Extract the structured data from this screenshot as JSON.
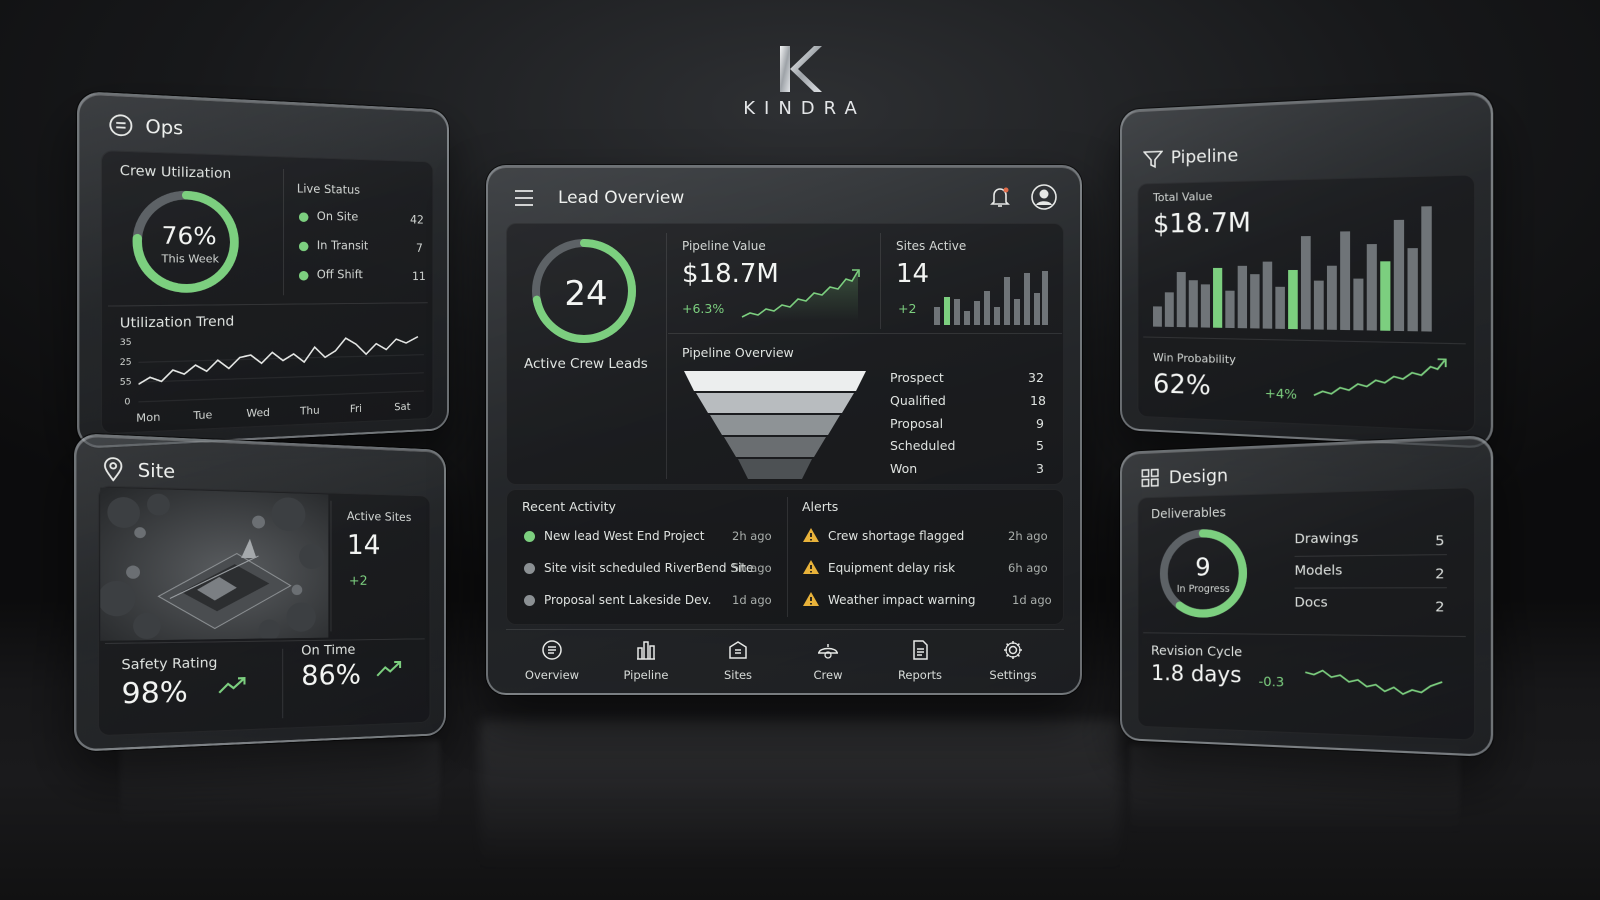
{
  "brand": {
    "mark": "K",
    "name": "KINDRA"
  },
  "colors": {
    "accent": "#7ccf7f",
    "panel_border": "#d7dee2",
    "warning": "#e8b23a"
  },
  "ops": {
    "title": "Ops",
    "icon": "ops-icon",
    "crew_utilization": {
      "label": "Crew Utilization",
      "value": "76%",
      "sub": "This Week",
      "percent": 76
    },
    "live_status": {
      "label": "Live Status",
      "items": [
        {
          "label": "On Site",
          "count": "42"
        },
        {
          "label": "In Transit",
          "count": "7"
        },
        {
          "label": "Off Shift",
          "count": "11"
        }
      ]
    },
    "trend": {
      "label": "Utilization Trend",
      "yticks": [
        "35",
        "25",
        "55",
        "0"
      ],
      "xticks": [
        "Mon",
        "Tue",
        "Wed",
        "Thu",
        "Fri",
        "Sat"
      ]
    }
  },
  "site": {
    "title": "Site",
    "icon": "map-pin-icon",
    "active_sites": {
      "label": "Active Sites",
      "value": "14",
      "delta": "+2"
    },
    "safety": {
      "label": "Safety Rating",
      "value": "98%"
    },
    "on_time": {
      "label": "On Time",
      "value": "86%"
    }
  },
  "main": {
    "title": "Lead Overview",
    "crew_leads": {
      "value": "24",
      "label": "Active Crew Leads",
      "ring_fraction": 0.72
    },
    "pipeline_value": {
      "label": "Pipeline Value",
      "value": "$18.7M",
      "delta": "+6.3%"
    },
    "sites_active": {
      "label": "Sites Active",
      "value": "14",
      "delta": "+2"
    },
    "funnel": {
      "label": "Pipeline Overview",
      "stages": [
        {
          "label": "Prospect",
          "count": "32"
        },
        {
          "label": "Qualified",
          "count": "18"
        },
        {
          "label": "Proposal",
          "count": "9"
        },
        {
          "label": "Scheduled",
          "count": "5"
        },
        {
          "label": "Won",
          "count": "3"
        }
      ]
    },
    "recent_activity": {
      "label": "Recent Activity",
      "items": [
        {
          "text": "New lead West End Project",
          "time": "2h ago",
          "active": true
        },
        {
          "text": "Site visit scheduled RiverBend Site",
          "time": "5h ago",
          "active": false
        },
        {
          "text": "Proposal sent Lakeside Dev.",
          "time": "1d ago",
          "active": false
        }
      ]
    },
    "alerts": {
      "label": "Alerts",
      "items": [
        {
          "text": "Crew shortage flagged",
          "time": "2h ago"
        },
        {
          "text": "Equipment delay risk",
          "time": "6h ago"
        },
        {
          "text": "Weather impact warning",
          "time": "1d ago"
        }
      ]
    },
    "nav": [
      {
        "label": "Overview",
        "icon": "overview-icon"
      },
      {
        "label": "Pipeline",
        "icon": "pipeline-icon"
      },
      {
        "label": "Sites",
        "icon": "sites-icon"
      },
      {
        "label": "Crew",
        "icon": "crew-icon"
      },
      {
        "label": "Reports",
        "icon": "reports-icon"
      },
      {
        "label": "Settings",
        "icon": "settings-icon"
      }
    ]
  },
  "pipeline": {
    "title": "Pipeline",
    "icon": "filter-icon",
    "total_value": {
      "label": "Total Value",
      "value": "$18.7M"
    },
    "win_probability": {
      "label": "Win Probability",
      "value": "62%",
      "delta": "+4%"
    }
  },
  "design": {
    "title": "Design",
    "icon": "grid-icon",
    "deliverables": {
      "label": "Deliverables",
      "value": "9",
      "sub": "In Progress",
      "ring_fraction": 0.6,
      "items": [
        {
          "label": "Drawings",
          "count": "5"
        },
        {
          "label": "Models",
          "count": "2"
        },
        {
          "label": "Docs",
          "count": "2"
        }
      ]
    },
    "revision_cycle": {
      "label": "Revision Cycle",
      "value": "1.8 days",
      "delta": "-0.3"
    }
  }
}
